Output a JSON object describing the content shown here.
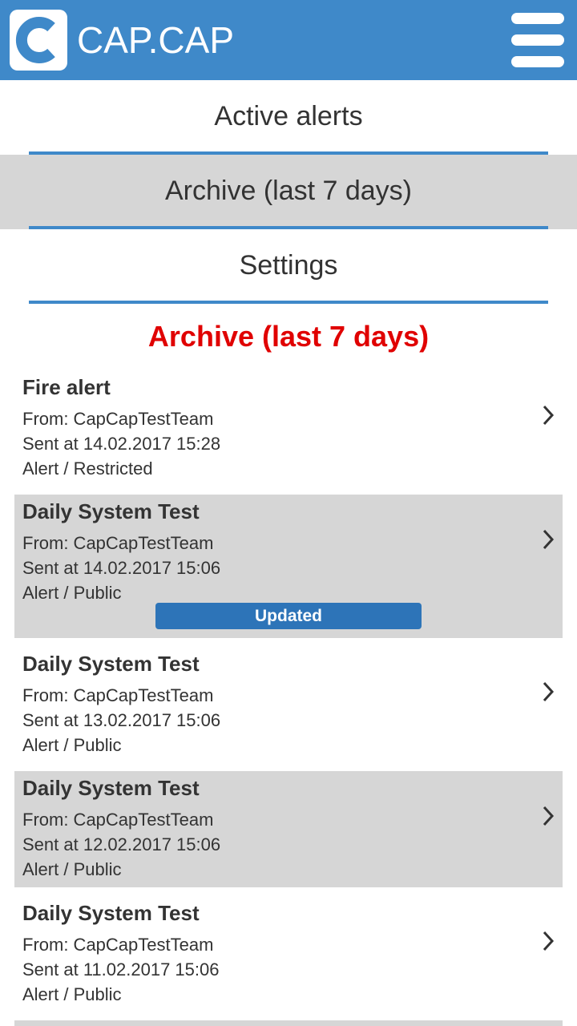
{
  "header": {
    "brand": "CAP.CAP",
    "logo_icon": "capcap-logo-icon",
    "menu_icon": "hamburger-menu-icon",
    "color": "#3f89c9"
  },
  "nav": {
    "items": [
      {
        "label": "Active alerts",
        "active": false
      },
      {
        "label": "Archive (last 7 days)",
        "active": true
      },
      {
        "label": "Settings",
        "active": false
      }
    ]
  },
  "section_title": "Archive (last 7 days)",
  "alerts": [
    {
      "title": "Fire alert",
      "from": "From: CapCapTestTeam",
      "sent": "Sent at 14.02.2017 15:28",
      "type": "Alert / Restricted",
      "shaded": false
    },
    {
      "title": "Daily System Test",
      "from": "From: CapCapTestTeam",
      "sent": "Sent at 14.02.2017 15:06",
      "type": "Alert / Public",
      "badge": "Updated",
      "shaded": true
    },
    {
      "title": "Daily System Test",
      "from": "From: CapCapTestTeam",
      "sent": "Sent at 13.02.2017 15:06",
      "type": "Alert / Public",
      "shaded": false
    },
    {
      "title": "Daily System Test",
      "from": "From: CapCapTestTeam",
      "sent": "Sent at 12.02.2017 15:06",
      "type": "Alert / Public",
      "shaded": true
    },
    {
      "title": "Daily System Test",
      "from": "From: CapCapTestTeam",
      "sent": "Sent at 11.02.2017 15:06",
      "type": "Alert / Public",
      "shaded": false
    }
  ]
}
